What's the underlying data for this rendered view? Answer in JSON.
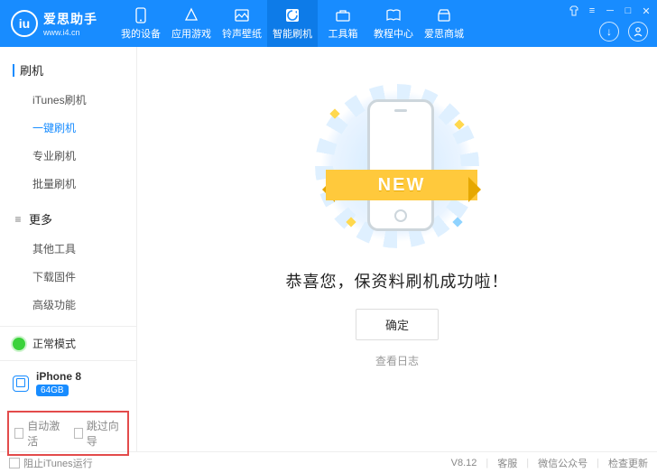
{
  "brand": {
    "logo_text": "iu",
    "name": "爱思助手",
    "url": "www.i4.cn"
  },
  "nav": {
    "items": [
      {
        "label": "我的设备"
      },
      {
        "label": "应用游戏"
      },
      {
        "label": "铃声壁纸"
      },
      {
        "label": "智能刷机"
      },
      {
        "label": "工具箱"
      },
      {
        "label": "教程中心"
      },
      {
        "label": "爱思商城"
      }
    ],
    "active_index": 3
  },
  "sidebar": {
    "group1": {
      "title": "刷机",
      "items": [
        "iTunes刷机",
        "一键刷机",
        "专业刷机",
        "批量刷机"
      ],
      "selected_index": 1
    },
    "group2": {
      "title": "更多",
      "items": [
        "其他工具",
        "下载固件",
        "高级功能"
      ]
    }
  },
  "mode": {
    "label": "正常模式"
  },
  "device": {
    "name": "iPhone 8",
    "capacity": "64GB"
  },
  "checks": {
    "auto_activate": "自动激活",
    "skip_guide": "跳过向导"
  },
  "main": {
    "ribbon": "NEW",
    "headline": "恭喜您，保资料刷机成功啦！",
    "confirm": "确定",
    "view_log": "查看日志"
  },
  "footer": {
    "block_itunes": "阻止iTunes运行",
    "version": "V8.12",
    "support": "客服",
    "wechat": "微信公众号",
    "check_update": "检查更新"
  }
}
